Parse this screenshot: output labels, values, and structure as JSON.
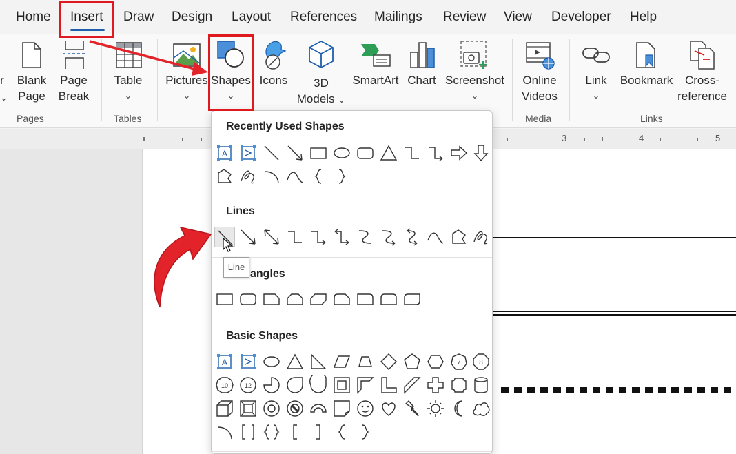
{
  "menu_tabs": [
    {
      "label": "Home"
    },
    {
      "label": "Insert",
      "active": true
    },
    {
      "label": "Draw"
    },
    {
      "label": "Design"
    },
    {
      "label": "Layout"
    },
    {
      "label": "References"
    },
    {
      "label": "Mailings"
    },
    {
      "label": "Review"
    },
    {
      "label": "View"
    },
    {
      "label": "Developer"
    },
    {
      "label": "Help"
    }
  ],
  "ribbon": {
    "partial_label": "r",
    "blank_page": {
      "line1": "Blank",
      "line2": "Page"
    },
    "page_break": {
      "line1": "Page",
      "line2": "Break"
    },
    "table": "Table",
    "pictures": "Pictures",
    "shapes": "Shapes",
    "icons": "Icons",
    "models_3d": {
      "line1": "3D",
      "line2": "Models"
    },
    "smartart": "SmartArt",
    "chart": "Chart",
    "screenshot": "Screenshot",
    "online_videos": {
      "line1": "Online",
      "line2": "Videos"
    },
    "link": "Link",
    "bookmark": "Bookmark",
    "cross_reference": {
      "line1": "Cross-",
      "line2": "reference"
    },
    "groups": {
      "pages": "Pages",
      "tables": "Tables",
      "media": "Media",
      "links": "Links"
    },
    "chevron": "⌄"
  },
  "ruler": {
    "numbers": [
      "3",
      "4",
      "5"
    ]
  },
  "shapes_menu": {
    "sections": {
      "recent": "Recently Used Shapes",
      "lines": "Lines",
      "rectangles": "angles",
      "basic": "Basic Shapes"
    },
    "tooltip": "Line",
    "basic_shape_numbers": [
      "7",
      "8",
      "10",
      "12"
    ]
  },
  "colors": {
    "accent_blue": "#1d5fad",
    "highlight_red": "#e0191f",
    "arrow_red": "#e3232a"
  }
}
